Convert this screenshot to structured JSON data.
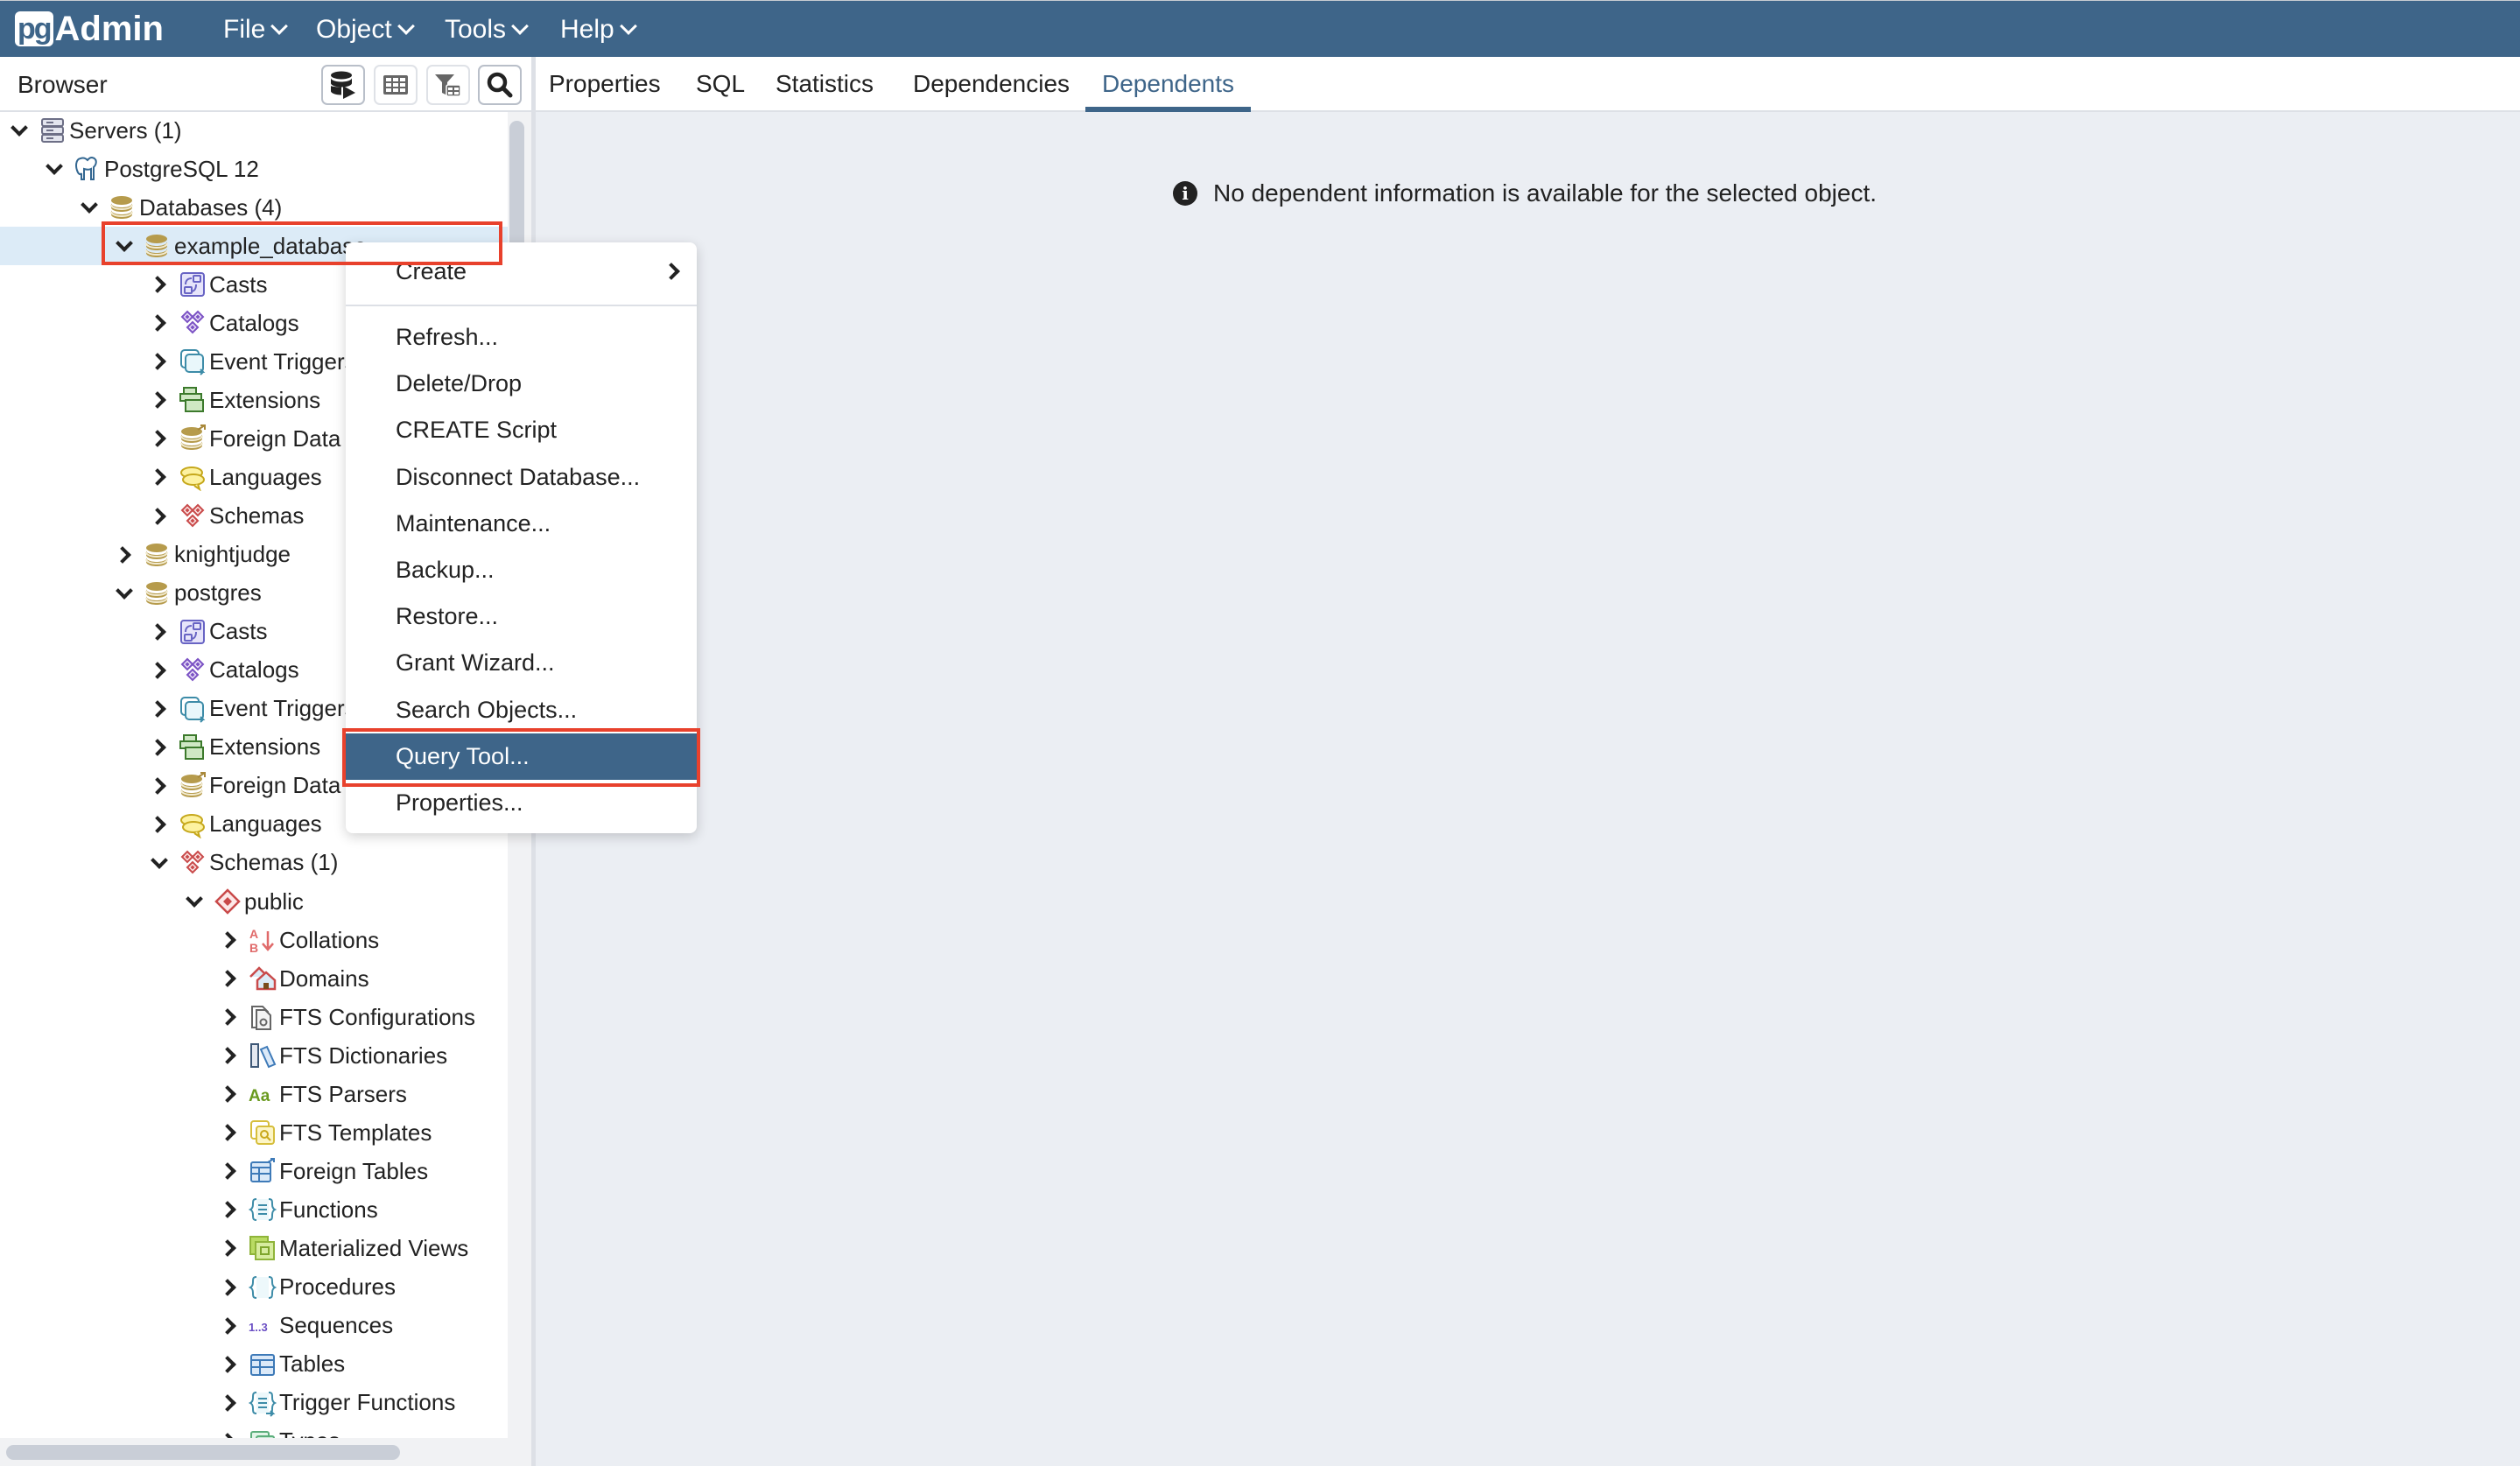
{
  "app": {
    "logo_pg": "pg",
    "logo_admin": "Admin",
    "menus": [
      "File",
      "Object",
      "Tools",
      "Help"
    ]
  },
  "browser": {
    "title": "Browser",
    "toolbar": [
      {
        "name": "query-tool-button",
        "icon": "database-play-icon",
        "enabled": true
      },
      {
        "name": "view-data-button",
        "icon": "table-grid-icon",
        "enabled": false
      },
      {
        "name": "filtered-rows-button",
        "icon": "filter-table-icon",
        "enabled": false
      },
      {
        "name": "search-objects-button",
        "icon": "search-icon",
        "enabled": true
      }
    ],
    "tree": [
      {
        "label": "Servers (1)",
        "level": 0,
        "state": "open",
        "icon": "servers-icon"
      },
      {
        "label": "PostgreSQL 12",
        "level": 1,
        "state": "open",
        "icon": "postgres-elephant-icon"
      },
      {
        "label": "Databases (4)",
        "level": 2,
        "state": "open",
        "icon": "databases-icon"
      },
      {
        "label": "example_database",
        "level": 3,
        "state": "open",
        "icon": "database-icon",
        "selected": true
      },
      {
        "label": "Casts",
        "level": 4,
        "state": "closed",
        "icon": "casts-icon"
      },
      {
        "label": "Catalogs",
        "level": 4,
        "state": "closed",
        "icon": "catalogs-icon"
      },
      {
        "label": "Event Triggers",
        "level": 4,
        "state": "closed",
        "icon": "event-triggers-icon"
      },
      {
        "label": "Extensions",
        "level": 4,
        "state": "closed",
        "icon": "extensions-icon"
      },
      {
        "label": "Foreign Data Wrappers",
        "level": 4,
        "state": "closed",
        "icon": "foreign-data-wrappers-icon"
      },
      {
        "label": "Languages",
        "level": 4,
        "state": "closed",
        "icon": "languages-icon"
      },
      {
        "label": "Schemas",
        "level": 4,
        "state": "closed",
        "icon": "schemas-icon"
      },
      {
        "label": "knightjudge",
        "level": 3,
        "state": "closed",
        "icon": "database-icon"
      },
      {
        "label": "postgres",
        "level": 3,
        "state": "open",
        "icon": "database-icon"
      },
      {
        "label": "Casts",
        "level": 4,
        "state": "closed",
        "icon": "casts-icon"
      },
      {
        "label": "Catalogs",
        "level": 4,
        "state": "closed",
        "icon": "catalogs-icon"
      },
      {
        "label": "Event Triggers",
        "level": 4,
        "state": "closed",
        "icon": "event-triggers-icon"
      },
      {
        "label": "Extensions",
        "level": 4,
        "state": "closed",
        "icon": "extensions-icon"
      },
      {
        "label": "Foreign Data Wrappers",
        "level": 4,
        "state": "closed",
        "icon": "foreign-data-wrappers-icon"
      },
      {
        "label": "Languages",
        "level": 4,
        "state": "closed",
        "icon": "languages-icon"
      },
      {
        "label": "Schemas (1)",
        "level": 4,
        "state": "open",
        "icon": "schemas-icon"
      },
      {
        "label": "public",
        "level": 5,
        "state": "open",
        "icon": "schema-icon"
      },
      {
        "label": "Collations",
        "level": 6,
        "state": "closed",
        "icon": "collations-icon"
      },
      {
        "label": "Domains",
        "level": 6,
        "state": "closed",
        "icon": "domains-icon"
      },
      {
        "label": "FTS Configurations",
        "level": 6,
        "state": "closed",
        "icon": "fts-configurations-icon"
      },
      {
        "label": "FTS Dictionaries",
        "level": 6,
        "state": "closed",
        "icon": "fts-dictionaries-icon"
      },
      {
        "label": "FTS Parsers",
        "level": 6,
        "state": "closed",
        "icon": "fts-parsers-icon"
      },
      {
        "label": "FTS Templates",
        "level": 6,
        "state": "closed",
        "icon": "fts-templates-icon"
      },
      {
        "label": "Foreign Tables",
        "level": 6,
        "state": "closed",
        "icon": "foreign-tables-icon"
      },
      {
        "label": "Functions",
        "level": 6,
        "state": "closed",
        "icon": "functions-icon"
      },
      {
        "label": "Materialized Views",
        "level": 6,
        "state": "closed",
        "icon": "materialized-views-icon"
      },
      {
        "label": "Procedures",
        "level": 6,
        "state": "closed",
        "icon": "procedures-icon"
      },
      {
        "label": "Sequences",
        "level": 6,
        "state": "closed",
        "icon": "sequences-icon"
      },
      {
        "label": "Tables",
        "level": 6,
        "state": "closed",
        "icon": "tables-icon"
      },
      {
        "label": "Trigger Functions",
        "level": 6,
        "state": "closed",
        "icon": "trigger-functions-icon"
      },
      {
        "label": "Types",
        "level": 6,
        "state": "closed",
        "icon": "types-icon"
      }
    ]
  },
  "main": {
    "tabs": [
      {
        "label": "Properties",
        "active": false
      },
      {
        "label": "SQL",
        "active": false
      },
      {
        "label": "Statistics",
        "active": false
      },
      {
        "label": "Dependencies",
        "active": false
      },
      {
        "label": "Dependents",
        "active": true
      }
    ],
    "info_message": "No dependent information is available for the selected object."
  },
  "context_menu": {
    "items": [
      {
        "label": "Create",
        "submenu": true
      },
      {
        "label": "Refresh..."
      },
      {
        "label": "Delete/Drop"
      },
      {
        "label": "CREATE Script"
      },
      {
        "label": "Disconnect Database..."
      },
      {
        "label": "Maintenance..."
      },
      {
        "label": "Backup..."
      },
      {
        "label": "Restore..."
      },
      {
        "label": "Grant Wizard..."
      },
      {
        "label": "Search Objects..."
      },
      {
        "label": "Query Tool...",
        "highlighted": true
      },
      {
        "label": "Properties..."
      }
    ]
  },
  "colors": {
    "brand": "#3e6589",
    "selected_row": "#dcebf7",
    "annotation": "#e8412c",
    "background": "#ebeef3"
  }
}
